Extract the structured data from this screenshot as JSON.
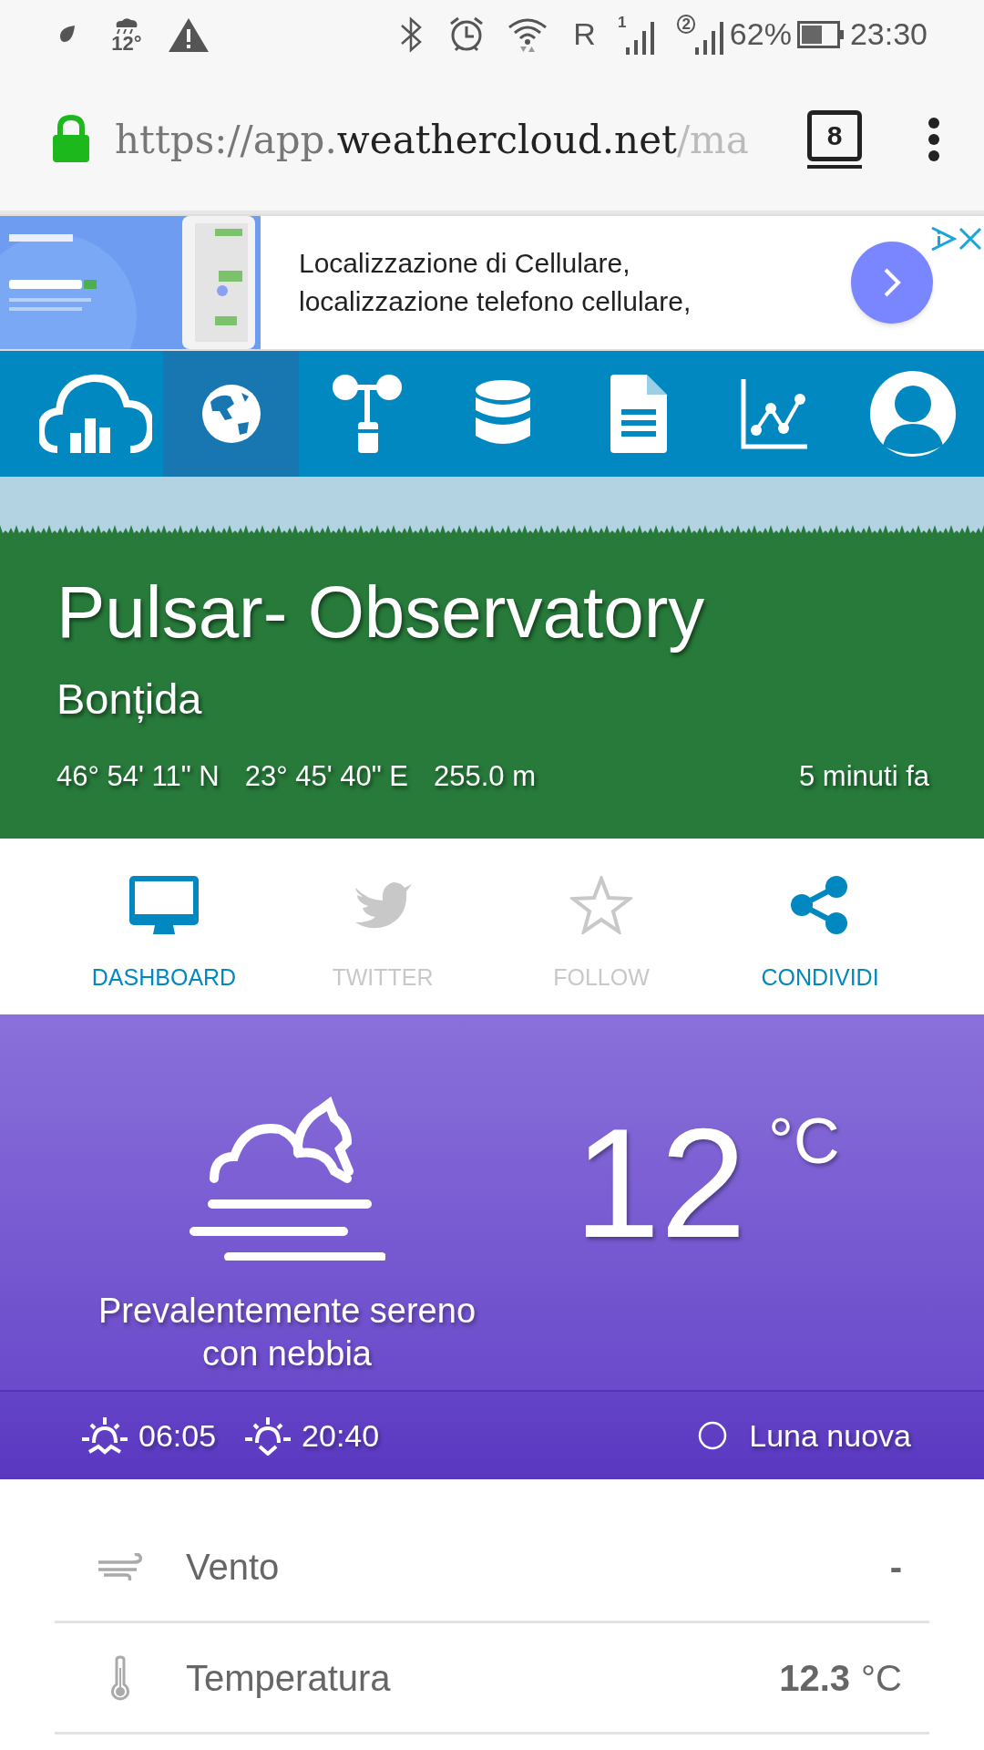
{
  "status_bar": {
    "weather_temp": "12°",
    "roaming": "R",
    "sim_1": "1",
    "sim_2": "2",
    "battery": "62%",
    "time": "23:30"
  },
  "browser": {
    "url_scheme": "https://app.",
    "url_domain": "weathercloud.net",
    "url_rest": "/ma",
    "tab_count": "8"
  },
  "ad": {
    "lines": [
      "Localizzazione di Cellulare,",
      "localizzazione telefono cellulare,"
    ]
  },
  "nav": [
    {
      "kind": "logo",
      "selected": false
    },
    {
      "kind": "globe",
      "selected": true
    },
    {
      "kind": "station",
      "selected": false
    },
    {
      "kind": "database",
      "selected": false
    },
    {
      "kind": "document",
      "selected": false
    },
    {
      "kind": "chart",
      "selected": false
    },
    {
      "kind": "avatar",
      "selected": false
    }
  ],
  "station": {
    "name": "Pulsar- Observatory",
    "place": "Bonțida",
    "latitude": "46° 54' 11\" N",
    "longitude": "23° 45' 40\" E",
    "altitude": "255.0 m",
    "updated": "5 minuti fa"
  },
  "actions": [
    {
      "kind": "dashboard",
      "label": "DASHBOARD",
      "disabled": false
    },
    {
      "kind": "twitter",
      "label": "TWITTER",
      "disabled": true
    },
    {
      "kind": "follow",
      "label": "FOLLOW",
      "disabled": true
    },
    {
      "kind": "share",
      "label": "CONDIVIDI",
      "disabled": false
    }
  ],
  "weather": {
    "condition": "Prevalentemente sereno con nebbia",
    "temperature": "12",
    "unit": "°C",
    "sunrise": "06:05",
    "sunset": "20:40",
    "moon": "Luna nuova"
  },
  "readings": [
    {
      "kind": "wind",
      "label": "Vento",
      "value": "-"
    },
    {
      "kind": "temperature",
      "label": "Temperatura",
      "value": "12.3",
      "unit": "°C"
    }
  ]
}
